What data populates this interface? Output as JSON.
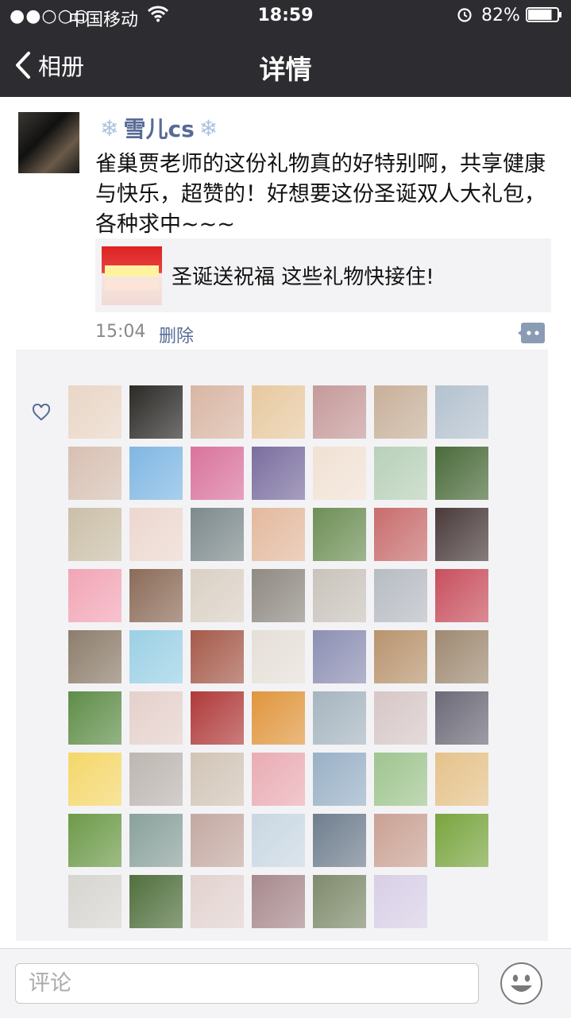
{
  "status_bar": {
    "signal": "●●○○○",
    "carrier": "中国移动",
    "time": "18:59",
    "battery_percent": "82%",
    "battery_level": 0.82
  },
  "nav": {
    "back_label": "相册",
    "title": "详情"
  },
  "post": {
    "author": "雪儿cs",
    "author_decoration": "❄",
    "text": "雀巢贾老师的这份礼物真的好特别啊，共享健康与快乐，超赞的！好想要这份圣诞双人大礼包，各种求中~~~",
    "shared_link": {
      "title": "圣诞送祝福 这些礼物快接住!"
    },
    "time": "15:04",
    "delete_label": "删除"
  },
  "likes": {
    "icon": "heart-outline-icon",
    "avatars": [
      "#e9d6c6",
      "#2b2a27",
      "#d9b6a4",
      "#e7c9a0",
      "#c59a9a",
      "#c8b09a",
      "#b4c2cf",
      "#d7c0b2",
      "#7fb7e3",
      "#d9739d",
      "#7a6e9f",
      "#f1e1d4",
      "#b8d0b8",
      "#4a6b3a",
      "#cbbfa8",
      "#ecd7cf",
      "#7d8a8c",
      "#e3b99d",
      "#6e8f56",
      "#c86d6d",
      "#4a3b3b",
      "#f2a5b6",
      "#8b6b58",
      "#dad0c4",
      "#8f8a82",
      "#c9c3bb",
      "#b7bcc3",
      "#c8505e",
      "#8d7d6b",
      "#9bd0e5",
      "#a55a4a",
      "#e6dfd8",
      "#8c8fb3",
      "#b8946e",
      "#9f8a72",
      "#5f8d48",
      "#e5d0cb",
      "#b03a3a",
      "#e0963d",
      "#a6b5c0",
      "#d7c7c7",
      "#6d6a78",
      "#f4d76a",
      "#bdb6b1",
      "#d1c4b6",
      "#e9acb4",
      "#99b0c6",
      "#9fc58f",
      "#e5c28a",
      "#6d9a49",
      "#8aa19b",
      "#c4a9a2",
      "#c9d7e2",
      "#6f7e8e",
      "#caa194",
      "#79a53f",
      "#d7d5d0",
      "#506f3d",
      "#e2d2cf",
      "#a8898d",
      "#7f8b6c",
      "#d8cfe6"
    ]
  },
  "comment_bar": {
    "placeholder": "评论",
    "emoji_icon": "smiley-face-icon"
  },
  "colors": {
    "nav_bg": "#2d2d31",
    "link_blue": "#576b95",
    "panel_bg": "#f3f3f5"
  }
}
